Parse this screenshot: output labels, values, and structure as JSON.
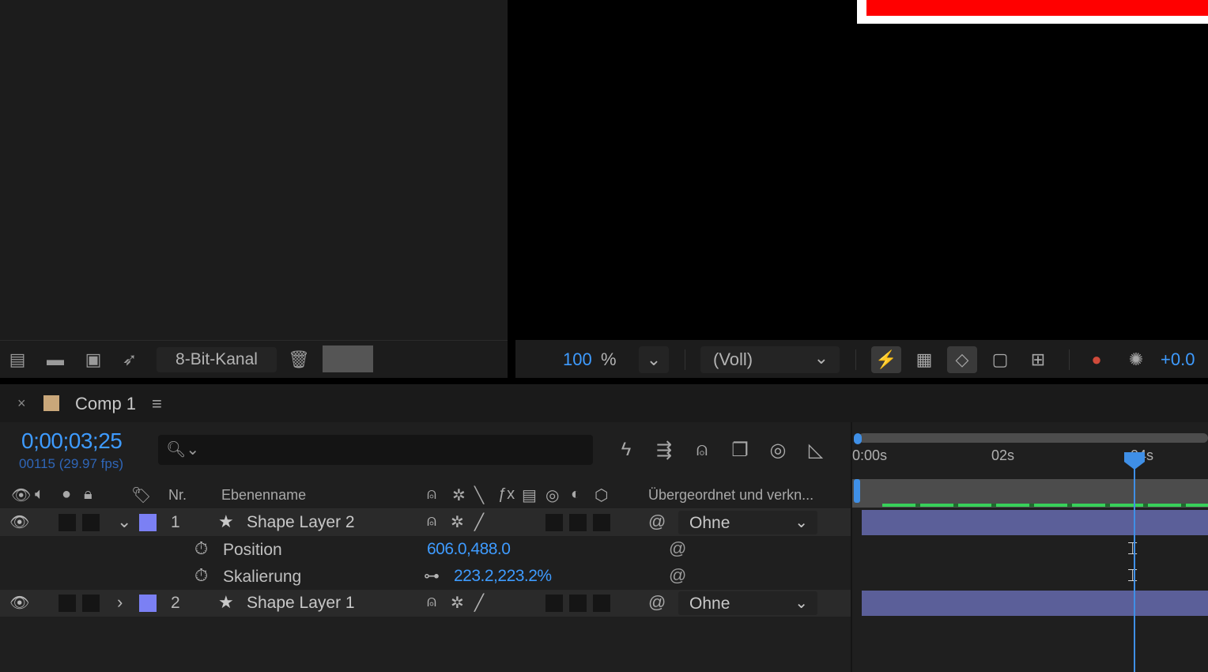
{
  "project_panel": {
    "bit_depth": "8-Bit-Kanal",
    "icons": [
      "interpret-footage-icon",
      "folder-icon",
      "composition-icon",
      "render-queue-icon",
      "trash-icon"
    ]
  },
  "viewer": {
    "zoom_value": "100",
    "zoom_unit": "%",
    "resolution": "(Voll)",
    "exposure": "+0.0"
  },
  "timeline": {
    "tab_close": "×",
    "comp_title": "Comp 1",
    "menu_glyph": "≡",
    "timecode": "0;00;03;25",
    "frame_info": "00115 (29.97 fps)",
    "search_glyph": "🔍︎⌄",
    "columns": {
      "number": "Nr.",
      "layer_name": "Ebenenname",
      "parent": "Übergeordnet und verkn..."
    },
    "ruler_ticks": [
      "0:00s",
      "02s",
      "04s"
    ],
    "layers": [
      {
        "number": "1",
        "name": "Shape Layer 2",
        "expanded": true,
        "parent": "Ohne",
        "properties": [
          {
            "name": "Position",
            "value": "606.0,488.0"
          },
          {
            "name": "Skalierung",
            "value": "223.2,223.2%"
          }
        ]
      },
      {
        "number": "2",
        "name": "Shape Layer 1",
        "expanded": false,
        "parent": "Ohne"
      }
    ]
  },
  "colors": {
    "accent_blue": "#3e9bff",
    "layer_label": "#7b80f4",
    "layer_bar": "#5b5f99",
    "comp_label": "#c9a77a",
    "frame_red": "#ff0000"
  }
}
